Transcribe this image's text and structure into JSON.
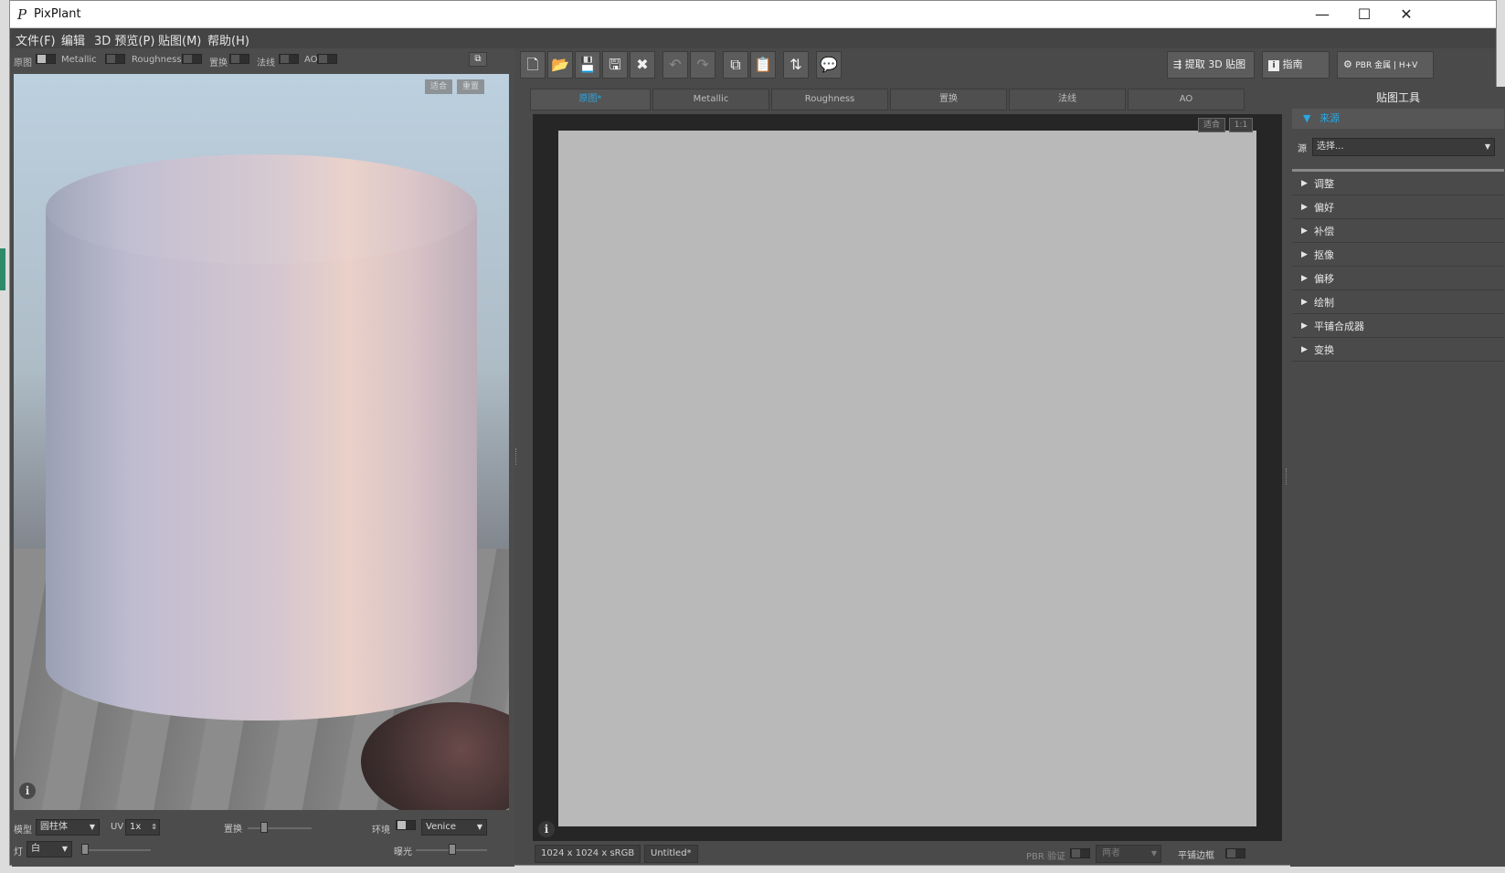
{
  "window": {
    "title": "PixPlant",
    "logo_glyph": "P",
    "minimize": "—",
    "maximize": "☐",
    "close": "✕"
  },
  "menu": [
    "文件(F)",
    "编辑",
    "3D 预览(P)",
    "贴图(M)",
    "帮助(H)"
  ],
  "preview": {
    "channels": [
      "原图",
      "Metallic",
      "Roughness",
      "置换",
      "法线",
      "AO"
    ],
    "fit_label": "适合",
    "reset_label": "重置",
    "info": "i",
    "model_label": "模型",
    "model_value": "圆柱体",
    "uv_label": "UV",
    "uv_value": "1x",
    "displace_label": "置换",
    "env_label": "环境",
    "env_value": "Venice",
    "light_label": "灯",
    "light_value": "白",
    "exposure_label": "曝光"
  },
  "toolbar": {
    "icons": [
      "new-file-icon",
      "open-folder-icon",
      "save-icon",
      "save-as-icon",
      "close-file-icon",
      "undo-icon",
      "redo-icon",
      "copy-icon",
      "paste-icon",
      "swap-icon",
      "comment-icon"
    ],
    "extract_label": "提取 3D 贴图",
    "guide_label": "指南",
    "pbr_label": "PBR 金属 | H+V"
  },
  "tabs": [
    {
      "label": "原图*",
      "active": true
    },
    {
      "label": "Metallic",
      "active": false
    },
    {
      "label": "Roughness",
      "active": false
    },
    {
      "label": "置换",
      "active": false
    },
    {
      "label": "法线",
      "active": false
    },
    {
      "label": "AO",
      "active": false
    }
  ],
  "canvas": {
    "fit_label": "适合",
    "one_to_one_label": "1:1",
    "info": "i",
    "size_text": "1024 x 1024 x sRGB",
    "doc_name": "Untitled*",
    "pbr_check_label": "PBR 验证",
    "pbr_check_value": "两者",
    "tile_edge_label": "平铺边框"
  },
  "tools": {
    "header": "贴图工具",
    "source_section": "来源",
    "source_label": "源",
    "source_value": "选择...",
    "items": [
      "调整",
      "偏好",
      "补偿",
      "抠像",
      "偏移",
      "绘制",
      "平铺合成器",
      "变换"
    ]
  },
  "colors": {
    "accent": "#2aa6e0",
    "panel": "#4a4a4a",
    "canvas_bg": "#262626",
    "canvas": "#b9b9b9"
  }
}
